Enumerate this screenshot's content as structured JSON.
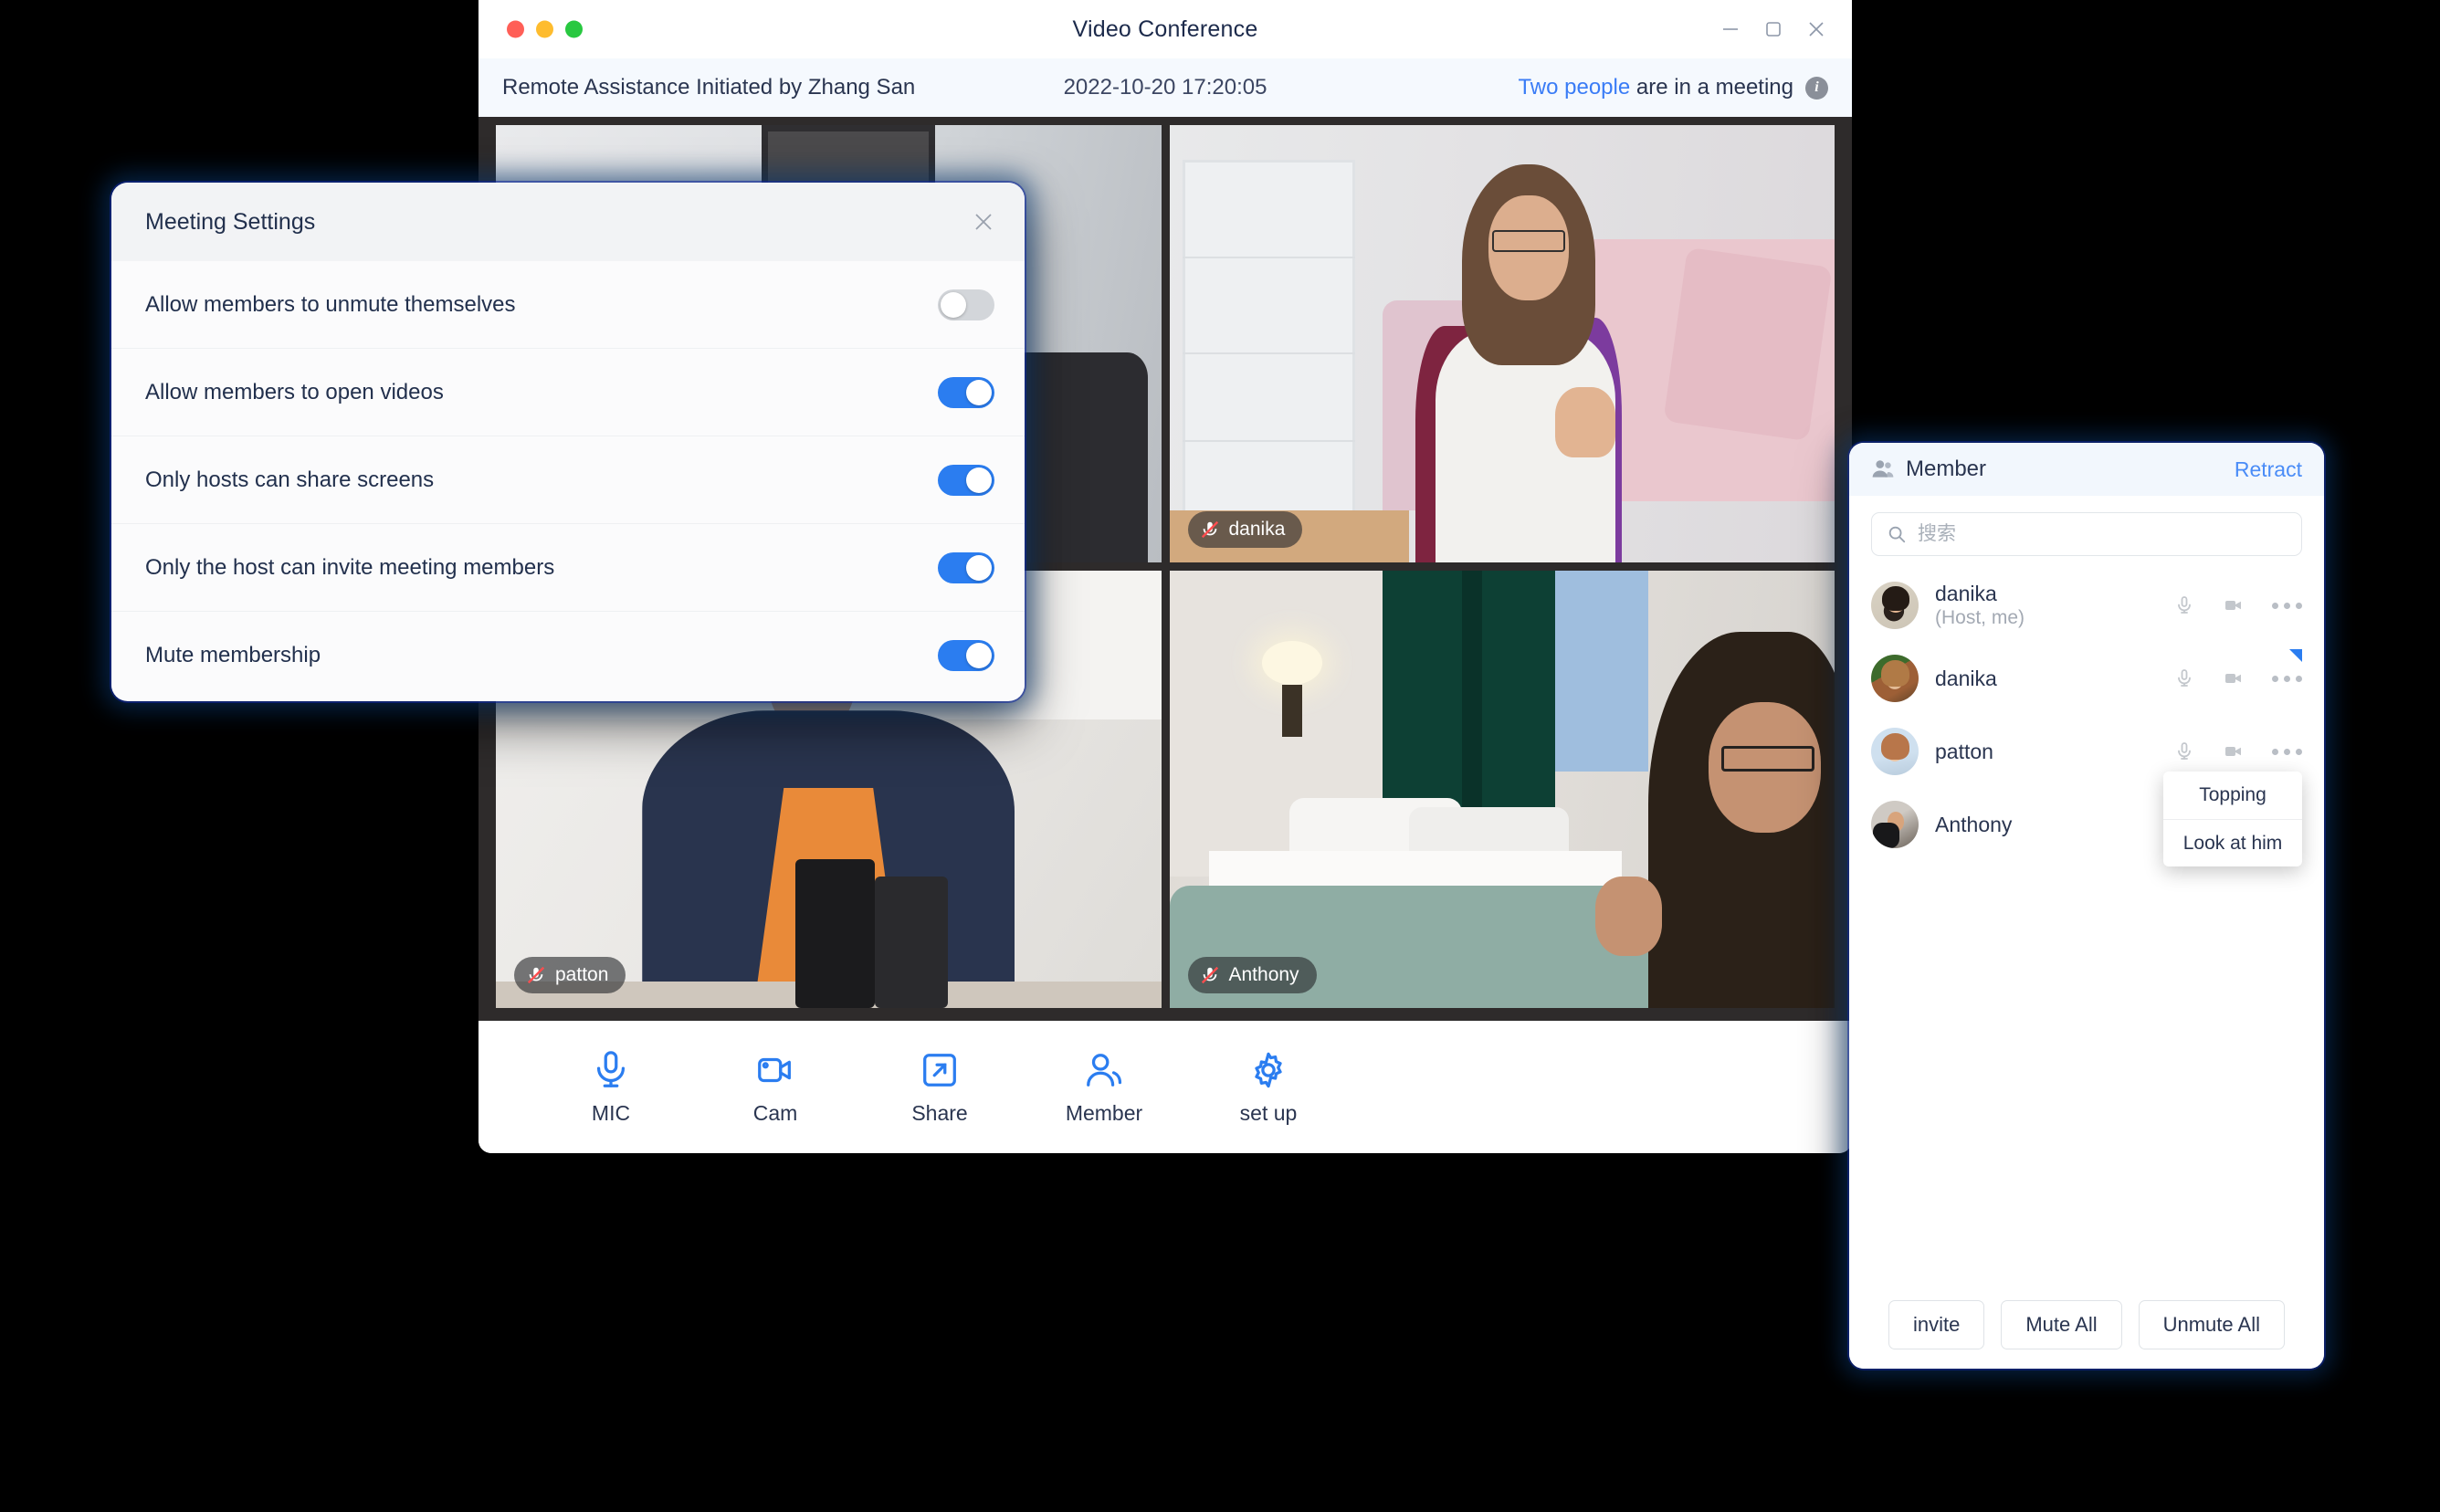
{
  "window": {
    "title": "Video Conference",
    "controls": {
      "minimize": "minimize-icon",
      "maximize": "maximize-icon",
      "close": "close-icon"
    },
    "traffic_lights": [
      "#ff5f57",
      "#febc2e",
      "#28c840"
    ]
  },
  "subheader": {
    "session_title": "Remote Assistance Initiated by Zhang San",
    "timestamp": "2022-10-20 17:20:05",
    "status_link": "Two people",
    "status_rest": " are in a meeting",
    "info_glyph": "i"
  },
  "video_tiles": [
    {
      "name": "",
      "muted": false,
      "scene": "s1"
    },
    {
      "name": "danika",
      "muted": true,
      "scene": "s2"
    },
    {
      "name": "patton",
      "muted": true,
      "scene": "s3"
    },
    {
      "name": "Anthony",
      "muted": true,
      "scene": "s4"
    }
  ],
  "toolbar": [
    {
      "label": "MIC",
      "icon": "microphone-icon"
    },
    {
      "label": "Cam",
      "icon": "camera-icon"
    },
    {
      "label": "Share",
      "icon": "share-screen-icon"
    },
    {
      "label": "Member",
      "icon": "people-icon"
    },
    {
      "label": "set up",
      "icon": "gear-icon"
    }
  ],
  "settings_dialog": {
    "title": "Meeting Settings",
    "close_label": "×",
    "rows": [
      {
        "label": "Allow members to unmute themselves",
        "on": false
      },
      {
        "label": "Allow members to open videos",
        "on": true
      },
      {
        "label": "Only hosts can share screens",
        "on": true
      },
      {
        "label": "Only the host can invite meeting members",
        "on": true
      },
      {
        "label": "Mute membership",
        "on": true
      }
    ]
  },
  "member_panel": {
    "title": "Member",
    "retract_label": "Retract",
    "search_placeholder": "搜索",
    "search_value": "",
    "members": [
      {
        "name": "danika",
        "role": "(Host, me)",
        "avatar": "av1",
        "marked": false
      },
      {
        "name": "danika",
        "role": "",
        "avatar": "av2",
        "marked": true
      },
      {
        "name": "patton",
        "role": "",
        "avatar": "av3",
        "marked": false
      },
      {
        "name": "Anthony",
        "role": "",
        "avatar": "av4",
        "marked": false
      }
    ],
    "context_menu": {
      "items": [
        "Topping",
        "Look at him"
      ]
    },
    "footer_buttons": [
      "invite",
      "Mute All",
      "Unmute All"
    ]
  },
  "colors": {
    "accent": "#2b7df0",
    "link": "#4a8cf7",
    "header_bg": "#f5f9fe",
    "video_bg": "#2e2b2b"
  }
}
